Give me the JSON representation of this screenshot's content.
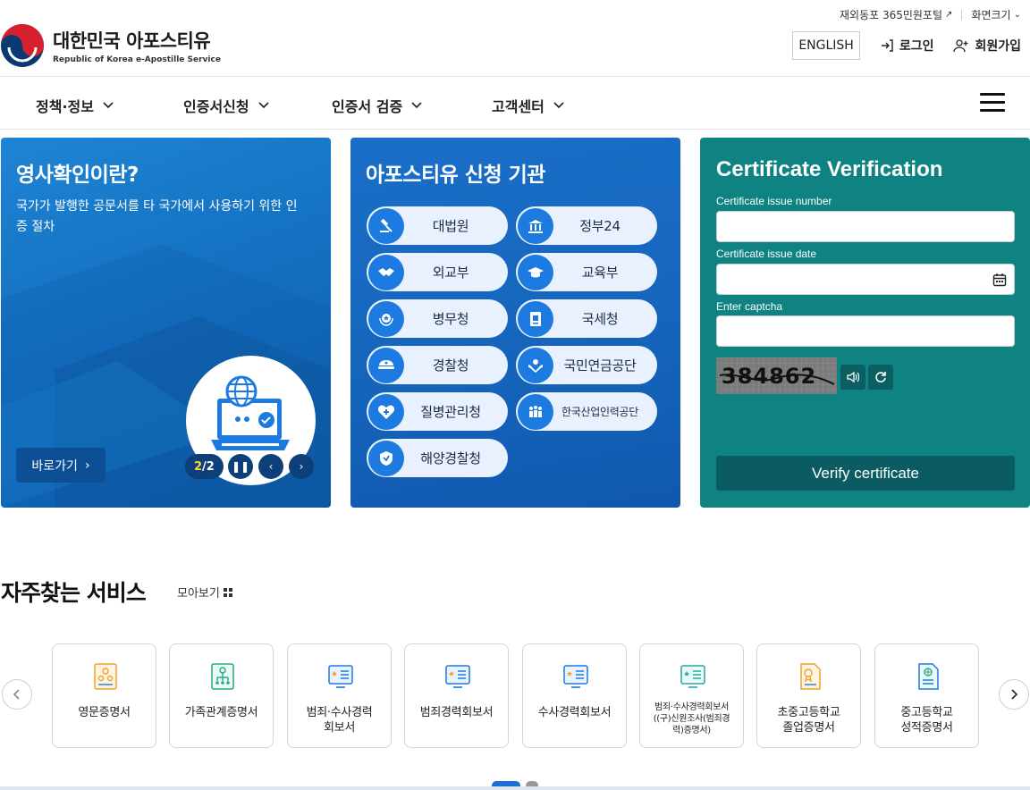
{
  "header": {
    "util_links": [
      "재외동포 365민원포털",
      "화면크기"
    ],
    "logo_title": "대한민국 아포스티유",
    "logo_subtitle": "Republic of Korea e-Apostille Service",
    "english_label": "ENGLISH",
    "login_label": "로그인",
    "signup_label": "회원가입"
  },
  "nav": {
    "items": [
      "정책·정보",
      "인증서신청",
      "인증서 검증",
      "고객센터"
    ]
  },
  "panel1": {
    "title": "영사확인이란?",
    "desc": "국가가 발행한 공문서를 타 국가에서 사용하기 위한 인증 절차",
    "go_label": "바로가기",
    "pager_current": "2",
    "pager_total": "/2"
  },
  "panel2": {
    "title": "아포스티유 신청 기관",
    "orgs": [
      {
        "label": "대법원",
        "icon": "gavel-icon"
      },
      {
        "label": "정부24",
        "icon": "government-building-icon"
      },
      {
        "label": "외교부",
        "icon": "handshake-icon"
      },
      {
        "label": "교육부",
        "icon": "graduation-cap-icon"
      },
      {
        "label": "병무청",
        "icon": "military-badge-icon"
      },
      {
        "label": "국세청",
        "icon": "tax-document-icon"
      },
      {
        "label": "경찰청",
        "icon": "police-cap-icon"
      },
      {
        "label": "국민연금공단",
        "icon": "pension-hands-icon"
      },
      {
        "label": "질병관리청",
        "icon": "health-heart-icon"
      },
      {
        "label": "한국산업인력공단",
        "icon": "workforce-people-icon"
      },
      {
        "label": "해양경찰청",
        "icon": "coast-guard-shield-icon"
      }
    ]
  },
  "panel3": {
    "title": "Certificate Verification",
    "issue_number_label": "Certificate issue number",
    "issue_date_label": "Certificate issue date",
    "captcha_label": "Enter captcha",
    "captcha_text": "384862",
    "verify_label": "Verify certificate"
  },
  "services": {
    "title": "자주찾는 서비스",
    "more_label": "모아보기",
    "cards": [
      {
        "line1": "영문증명서",
        "line2": "",
        "line3": "",
        "icon": "family-cert-icon"
      },
      {
        "line1": "가족관계증명서",
        "line2": "",
        "line3": "",
        "icon": "family-tree-icon"
      },
      {
        "line1": "범죄·수사경력",
        "line2": "회보서",
        "line3": "",
        "icon": "record-report-icon"
      },
      {
        "line1": "범죄경력회보서",
        "line2": "",
        "line3": "",
        "icon": "record-report-icon"
      },
      {
        "line1": "수사경력회보서",
        "line2": "",
        "line3": "",
        "icon": "record-report-icon"
      },
      {
        "line1": "범죄·수사경력회보서",
        "line2": "((구)신원조사(범죄경",
        "line3": "력)증명서)",
        "icon": "record-report-icon"
      },
      {
        "line1": "초중고등학교",
        "line2": "졸업증명서",
        "line3": "",
        "icon": "diploma-icon"
      },
      {
        "line1": "중고등학교",
        "line2": "성적증명서",
        "line3": "",
        "icon": "transcript-icon"
      }
    ]
  },
  "colors": {
    "panel1": "#1470c0",
    "panel2": "#1564bb",
    "panel3": "#0f8282",
    "verify_button": "#0b5c62",
    "icon_blue": "#1d7ae0"
  }
}
